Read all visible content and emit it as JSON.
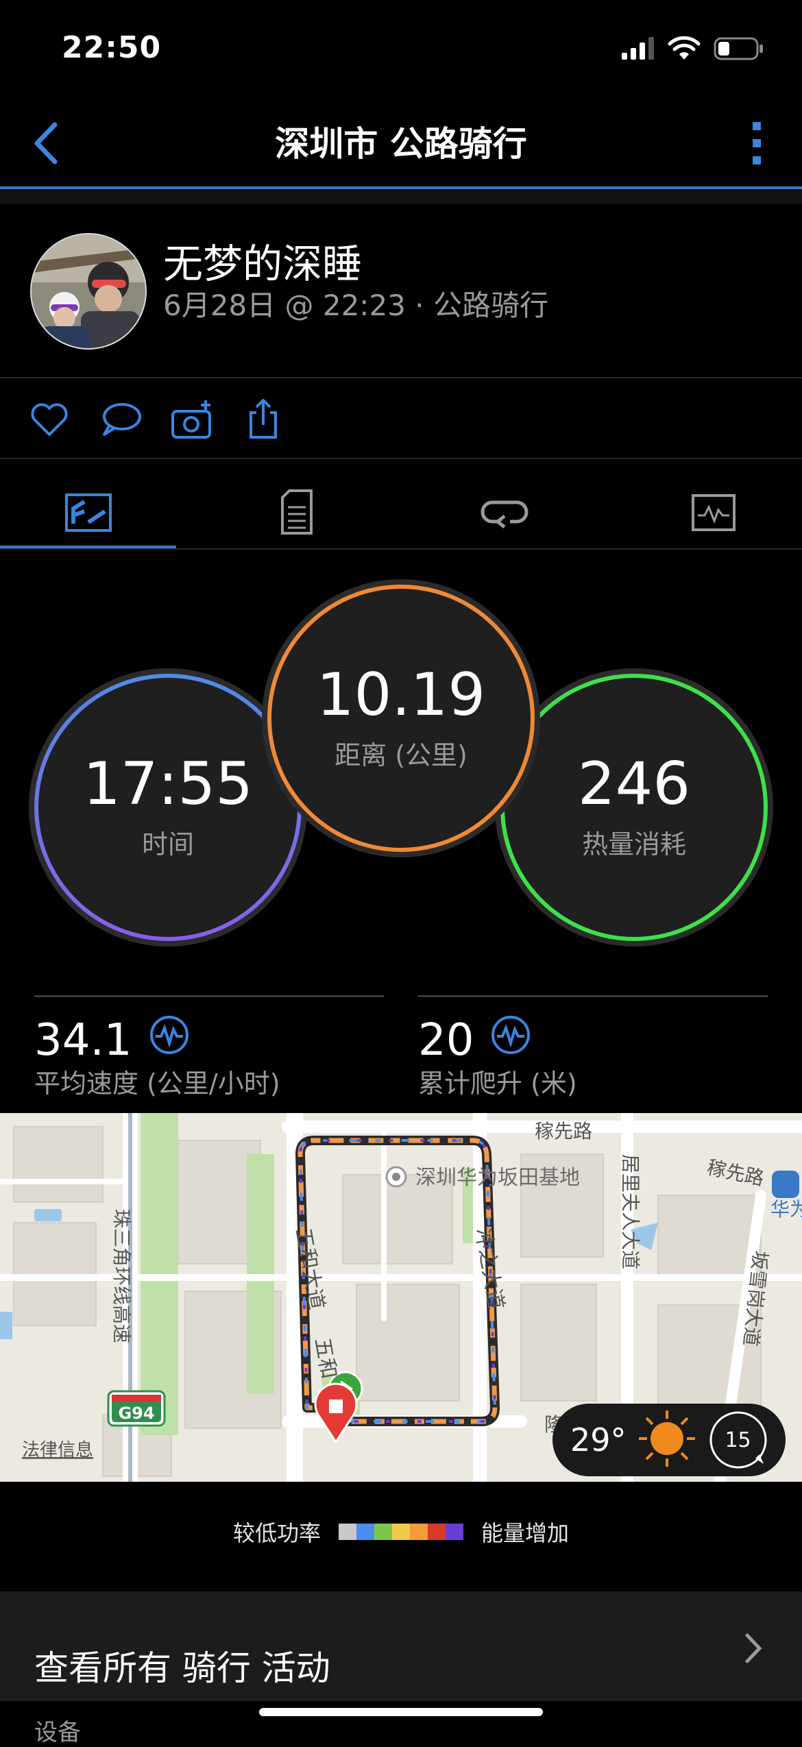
{
  "status_bar": {
    "time": "22:50",
    "icons": [
      "signal-icon",
      "wifi-icon",
      "battery-icon"
    ]
  },
  "nav": {
    "title": "深圳市 公路骑行",
    "back_icon": "chevron-left-icon",
    "more_icon": "more-vertical-icon"
  },
  "profile": {
    "name": "无梦的深睡",
    "meta": "6月28日 @ 22:23 · 公路骑行"
  },
  "actions": [
    "heart-icon",
    "comment-icon",
    "camera-add-icon",
    "share-icon"
  ],
  "tabs": [
    "summary-icon",
    "details-icon",
    "laps-icon",
    "graphs-icon"
  ],
  "circles": {
    "time": {
      "value": "17:55",
      "label": "时间"
    },
    "distance": {
      "value": "10.19",
      "label": "距离 (公里)"
    },
    "calories": {
      "value": "246",
      "label": "热量消耗"
    }
  },
  "stats": [
    {
      "value": "34.1",
      "label": "平均速度 (公里/小时)"
    },
    {
      "value": "20",
      "label": "累计爬升 (米)"
    }
  ],
  "map": {
    "labels": {
      "poi": "深圳华为坂田基地",
      "road1": "稼先路",
      "road2": "稼先路",
      "road3": "居里夫人大道",
      "road4": "冲之大道",
      "road5": "五和大道",
      "road6": "五和",
      "road7": "珠三角环线高速",
      "road8": "坂雪岗大道",
      "shield": "G94",
      "legal": "法律信息",
      "partial1": "华为",
      "partial2": "隆"
    },
    "weather": {
      "temp": "29°",
      "wind": "15"
    }
  },
  "legend": {
    "low": "较低功率",
    "high": "能量增加",
    "colors": [
      "#c9c9c9",
      "#4a8cf0",
      "#7cc84a",
      "#f2c94c",
      "#f29d38",
      "#d9392b",
      "#6a3cd6"
    ]
  },
  "footer": {
    "link": "查看所有 骑行 活动",
    "section": "设备"
  },
  "colors": {
    "accent": "#3a78c8",
    "time_ring": "#5a7de8",
    "distance_ring": "#f08a35",
    "calories_ring": "#3ee04a"
  }
}
